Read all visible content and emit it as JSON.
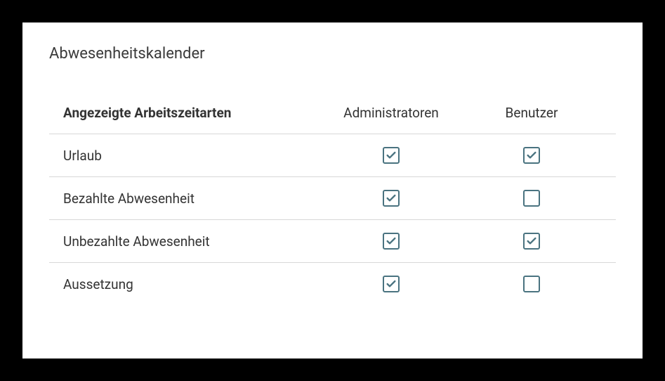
{
  "panel": {
    "title": "Abwesenheitskalender"
  },
  "table": {
    "headers": {
      "label": "Angezeigte Arbeitszeitarten",
      "col1": "Administratoren",
      "col2": "Benutzer"
    },
    "rows": [
      {
        "label": "Urlaub",
        "admin": true,
        "user": true
      },
      {
        "label": "Bezahlte Abwesenheit",
        "admin": true,
        "user": false
      },
      {
        "label": "Unbezahlte Abwesenheit",
        "admin": true,
        "user": true
      },
      {
        "label": "Aussetzung",
        "admin": true,
        "user": false
      }
    ]
  }
}
